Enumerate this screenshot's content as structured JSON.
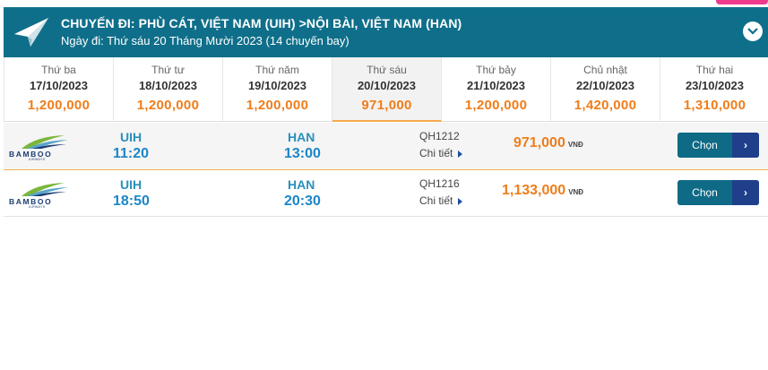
{
  "header": {
    "title": "CHUYẾN ĐI: PHÙ CÁT, VIỆT NAM (UIH) >NỘI BÀI, VIỆT NAM (HAN)",
    "subtitle": "Ngày đi: Thứ sáu 20 Tháng Mười 2023 (14 chuyến bay)",
    "icon": "paper-plane-icon",
    "collapse_icon": "chevron-down-icon"
  },
  "dates": [
    {
      "dow": "Thứ ba",
      "date": "17/10/2023",
      "price": "1,200,000",
      "active": false
    },
    {
      "dow": "Thứ tư",
      "date": "18/10/2023",
      "price": "1,200,000",
      "active": false
    },
    {
      "dow": "Thứ năm",
      "date": "19/10/2023",
      "price": "1,200,000",
      "active": false
    },
    {
      "dow": "Thứ sáu",
      "date": "20/10/2023",
      "price": "971,000",
      "active": true
    },
    {
      "dow": "Thứ bảy",
      "date": "21/10/2023",
      "price": "1,200,000",
      "active": false
    },
    {
      "dow": "Chủ nhật",
      "date": "22/10/2023",
      "price": "1,420,000",
      "active": false
    },
    {
      "dow": "Thứ hai",
      "date": "23/10/2023",
      "price": "1,310,000",
      "active": false
    }
  ],
  "airline": {
    "name": "BAMBOO",
    "tagline": "AIRWAYS"
  },
  "flights": [
    {
      "from": "UIH",
      "dep": "11:20",
      "to": "HAN",
      "arr": "13:00",
      "flight_no": "QH1212",
      "detail": "Chi tiết",
      "price": "971,000",
      "currency": "VNĐ",
      "select": "Chọn",
      "select_arrow": "›"
    },
    {
      "from": "UIH",
      "dep": "18:50",
      "to": "HAN",
      "arr": "20:30",
      "flight_no": "QH1216",
      "detail": "Chi tiết",
      "price": "1,133,000",
      "currency": "VNĐ",
      "select": "Chọn",
      "select_arrow": "›"
    }
  ],
  "colors": {
    "header_bg": "#0f6f8a",
    "price": "#f07d1a",
    "time": "#1b86c7",
    "button": "#0f6a86",
    "button_arrow": "#1f3f8a",
    "accent_pink": "#f03a8c"
  }
}
